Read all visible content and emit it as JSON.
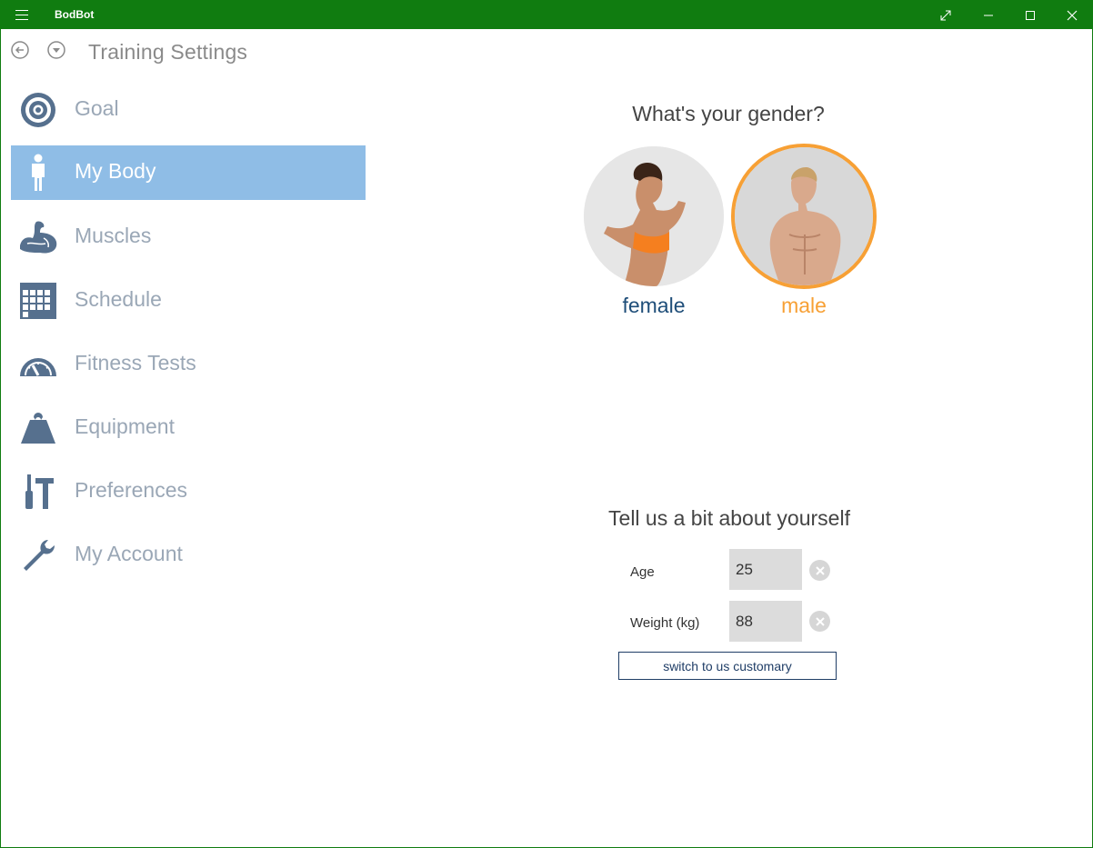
{
  "window": {
    "title": "BodBot",
    "accent": "#107c10"
  },
  "header": {
    "title": "Training Settings"
  },
  "sidebar": {
    "items": [
      {
        "label": "Goal",
        "icon": "target-icon"
      },
      {
        "label": "My Body",
        "icon": "person-icon",
        "active": true
      },
      {
        "label": "Muscles",
        "icon": "flexed-arm-icon"
      },
      {
        "label": "Schedule",
        "icon": "calendar-grid-icon"
      },
      {
        "label": "Fitness Tests",
        "icon": "speedometer-icon"
      },
      {
        "label": "Equipment",
        "icon": "weight-icon"
      },
      {
        "label": "Preferences",
        "icon": "tools-icon"
      },
      {
        "label": "My Account",
        "icon": "wrench-icon"
      }
    ],
    "active_color": "#8fbde6",
    "icon_color": "#56708e"
  },
  "gender": {
    "question": "What's your gender?",
    "options": [
      {
        "label": "female",
        "color": "#1f4e79",
        "selected": false
      },
      {
        "label": "male",
        "color": "#f7a035",
        "selected": true
      }
    ]
  },
  "about": {
    "title": "Tell us a bit about yourself",
    "age": {
      "label": "Age",
      "value": "25"
    },
    "weight": {
      "label": "Weight (kg)",
      "value": "88"
    },
    "switch_label": "switch to us customary"
  }
}
